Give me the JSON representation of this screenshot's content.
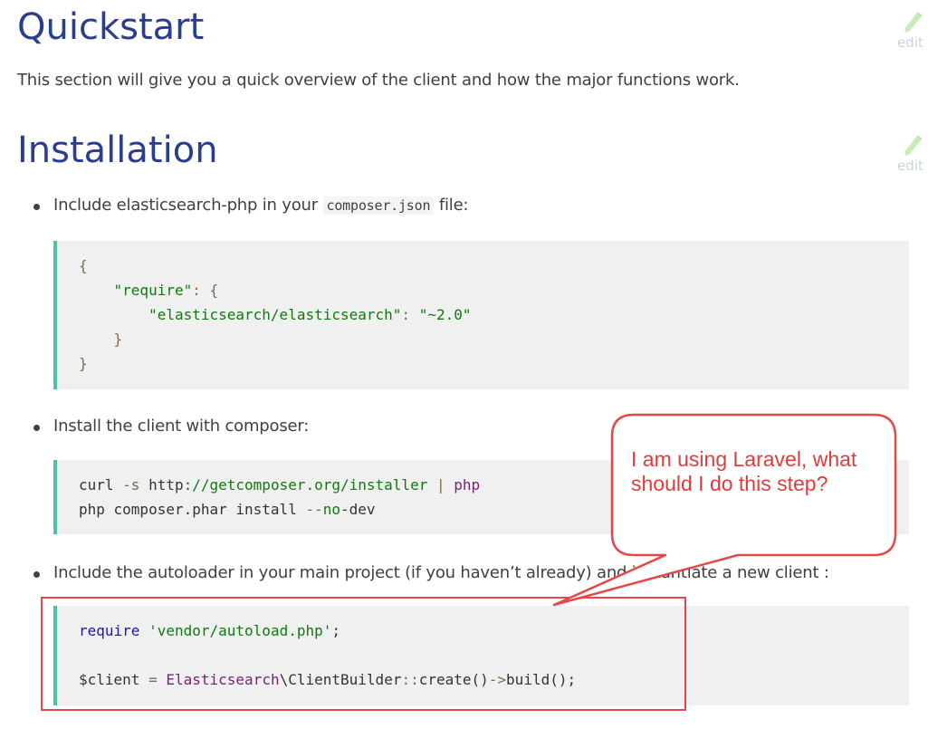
{
  "sections": {
    "quickstart_title": "Quickstart",
    "quickstart_intro": "This section will give you a quick overview of the client and how the major functions work.",
    "installation_title": "Installation",
    "edit_label": "edit"
  },
  "steps": [
    {
      "before": "Include elasticsearch-php in your",
      "code": "composer.json",
      "after": "file:"
    },
    {
      "text": "Install the client with composer:"
    },
    {
      "text": "Include the autoloader in your main project (if you haven’t already)  and instantiate a new client :"
    }
  ],
  "code_blocks": {
    "composer": {
      "l1": "{",
      "require_key": "\"require\"",
      "require_rest": ": {",
      "pkg": "\"elasticsearch/elasticsearch\"",
      "colon": ": ",
      "ver": "\"~2.0\"",
      "l4": "}",
      "l5": "}"
    },
    "install": {
      "curl": "curl",
      "flag": "-s",
      "url": "http",
      "url_rest": "://getcomposer.org/installer",
      "pipe": "|",
      "php1": "php",
      "php2": "php composer.phar install",
      "dash": "--",
      "nodev": "no",
      "dev": "-dev"
    },
    "autoload": {
      "require_kw": "require",
      "path": "'vendor/autoload.php'",
      "semi": ";",
      "var": "$client",
      "eq": "=",
      "ns": "Elasticsearch",
      "cls": "\\ClientBuilder",
      "sep": "::",
      "create": "create()",
      "arrow": "->",
      "build": "build();"
    }
  },
  "annotation": {
    "text": "I am using Laravel, what should I do this step?",
    "color": "#e5474a"
  }
}
